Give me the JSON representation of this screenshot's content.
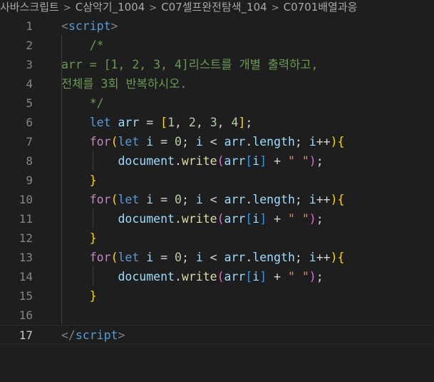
{
  "breadcrumb": {
    "items": [
      "사바스크립트",
      "C삼악기_1004",
      "C07셀프완전탐색_104",
      "C0701배열과응"
    ],
    "separator": ">"
  },
  "editor": {
    "active_line": 17,
    "lines": [
      {
        "n": "1",
        "tokens": [
          [
            "<",
            "tag"
          ],
          [
            "script",
            "tagname"
          ],
          [
            ">",
            "tag"
          ]
        ]
      },
      {
        "n": "2",
        "tokens": [
          [
            "    /*",
            "comment"
          ]
        ]
      },
      {
        "n": "3",
        "tokens": [
          [
            "arr = [1, 2, 3, 4]리스트를 개별 출력하고,",
            "comment"
          ]
        ]
      },
      {
        "n": "4",
        "tokens": [
          [
            "전체를 3회 반복하시오.",
            "comment"
          ]
        ]
      },
      {
        "n": "5",
        "tokens": [
          [
            "    */",
            "comment"
          ]
        ]
      },
      {
        "n": "6",
        "tokens": [
          [
            "    ",
            "plain"
          ],
          [
            "let",
            "kw"
          ],
          [
            " ",
            "plain"
          ],
          [
            "arr",
            "var"
          ],
          [
            " = ",
            "plain"
          ],
          [
            "[",
            "p1"
          ],
          [
            "1",
            "num"
          ],
          [
            ", ",
            "plain"
          ],
          [
            "2",
            "num"
          ],
          [
            ", ",
            "plain"
          ],
          [
            "3",
            "num"
          ],
          [
            ", ",
            "plain"
          ],
          [
            "4",
            "num"
          ],
          [
            "]",
            "p1"
          ],
          [
            ";",
            "plain"
          ]
        ]
      },
      {
        "n": "7",
        "tokens": [
          [
            "    ",
            "plain"
          ],
          [
            "for",
            "ctrl"
          ],
          [
            "(",
            "p1"
          ],
          [
            "let",
            "kw"
          ],
          [
            " ",
            "plain"
          ],
          [
            "i",
            "var"
          ],
          [
            " = ",
            "plain"
          ],
          [
            "0",
            "num"
          ],
          [
            "; ",
            "plain"
          ],
          [
            "i",
            "var"
          ],
          [
            " < ",
            "plain"
          ],
          [
            "arr",
            "var"
          ],
          [
            ".",
            "plain"
          ],
          [
            "length",
            "var"
          ],
          [
            "; ",
            "plain"
          ],
          [
            "i",
            "var"
          ],
          [
            "++",
            "plain"
          ],
          [
            ")",
            "p1"
          ],
          [
            "{",
            "p1"
          ]
        ]
      },
      {
        "n": "8",
        "tokens": [
          [
            "        ",
            "plain"
          ],
          [
            "document",
            "var"
          ],
          [
            ".",
            "plain"
          ],
          [
            "write",
            "fn"
          ],
          [
            "(",
            "p2"
          ],
          [
            "arr",
            "var"
          ],
          [
            "[",
            "p3"
          ],
          [
            "i",
            "var"
          ],
          [
            "]",
            "p3"
          ],
          [
            " + ",
            "plain"
          ],
          [
            "\" \"",
            "str"
          ],
          [
            ")",
            "p2"
          ],
          [
            ";",
            "plain"
          ]
        ]
      },
      {
        "n": "9",
        "tokens": [
          [
            "    ",
            "plain"
          ],
          [
            "}",
            "p1"
          ]
        ]
      },
      {
        "n": "10",
        "tokens": [
          [
            "    ",
            "plain"
          ],
          [
            "for",
            "ctrl"
          ],
          [
            "(",
            "p1"
          ],
          [
            "let",
            "kw"
          ],
          [
            " ",
            "plain"
          ],
          [
            "i",
            "var"
          ],
          [
            " = ",
            "plain"
          ],
          [
            "0",
            "num"
          ],
          [
            "; ",
            "plain"
          ],
          [
            "i",
            "var"
          ],
          [
            " < ",
            "plain"
          ],
          [
            "arr",
            "var"
          ],
          [
            ".",
            "plain"
          ],
          [
            "length",
            "var"
          ],
          [
            "; ",
            "plain"
          ],
          [
            "i",
            "var"
          ],
          [
            "++",
            "plain"
          ],
          [
            ")",
            "p1"
          ],
          [
            "{",
            "p1"
          ]
        ]
      },
      {
        "n": "11",
        "tokens": [
          [
            "        ",
            "plain"
          ],
          [
            "document",
            "var"
          ],
          [
            ".",
            "plain"
          ],
          [
            "write",
            "fn"
          ],
          [
            "(",
            "p2"
          ],
          [
            "arr",
            "var"
          ],
          [
            "[",
            "p3"
          ],
          [
            "i",
            "var"
          ],
          [
            "]",
            "p3"
          ],
          [
            " + ",
            "plain"
          ],
          [
            "\" \"",
            "str"
          ],
          [
            ")",
            "p2"
          ],
          [
            ";",
            "plain"
          ]
        ]
      },
      {
        "n": "12",
        "tokens": [
          [
            "    ",
            "plain"
          ],
          [
            "}",
            "p1"
          ]
        ]
      },
      {
        "n": "13",
        "tokens": [
          [
            "    ",
            "plain"
          ],
          [
            "for",
            "ctrl"
          ],
          [
            "(",
            "p1"
          ],
          [
            "let",
            "kw"
          ],
          [
            " ",
            "plain"
          ],
          [
            "i",
            "var"
          ],
          [
            " = ",
            "plain"
          ],
          [
            "0",
            "num"
          ],
          [
            "; ",
            "plain"
          ],
          [
            "i",
            "var"
          ],
          [
            " < ",
            "plain"
          ],
          [
            "arr",
            "var"
          ],
          [
            ".",
            "plain"
          ],
          [
            "length",
            "var"
          ],
          [
            "; ",
            "plain"
          ],
          [
            "i",
            "var"
          ],
          [
            "++",
            "plain"
          ],
          [
            ")",
            "p1"
          ],
          [
            "{",
            "p1"
          ]
        ]
      },
      {
        "n": "14",
        "tokens": [
          [
            "        ",
            "plain"
          ],
          [
            "document",
            "var"
          ],
          [
            ".",
            "plain"
          ],
          [
            "write",
            "fn"
          ],
          [
            "(",
            "p2"
          ],
          [
            "arr",
            "var"
          ],
          [
            "[",
            "p3"
          ],
          [
            "i",
            "var"
          ],
          [
            "]",
            "p3"
          ],
          [
            " + ",
            "plain"
          ],
          [
            "\" \"",
            "str"
          ],
          [
            ")",
            "p2"
          ],
          [
            ";",
            "plain"
          ]
        ]
      },
      {
        "n": "15",
        "tokens": [
          [
            "    ",
            "plain"
          ],
          [
            "}",
            "p1"
          ]
        ]
      },
      {
        "n": "16",
        "tokens": []
      },
      {
        "n": "17",
        "tokens": [
          [
            "</",
            "tag"
          ],
          [
            "script",
            "tagname"
          ],
          [
            ">",
            "tag"
          ]
        ]
      }
    ]
  },
  "colors": {
    "background": "#1e1e1e",
    "keyword": "#569cd6",
    "control": "#c586c0",
    "variable": "#9cdcfe",
    "number": "#b5cea8",
    "string": "#ce9178",
    "function": "#dcdcaa",
    "comment": "#6a9955",
    "bracket1": "#ffd700",
    "bracket2": "#da70d6",
    "bracket3": "#179fff"
  }
}
